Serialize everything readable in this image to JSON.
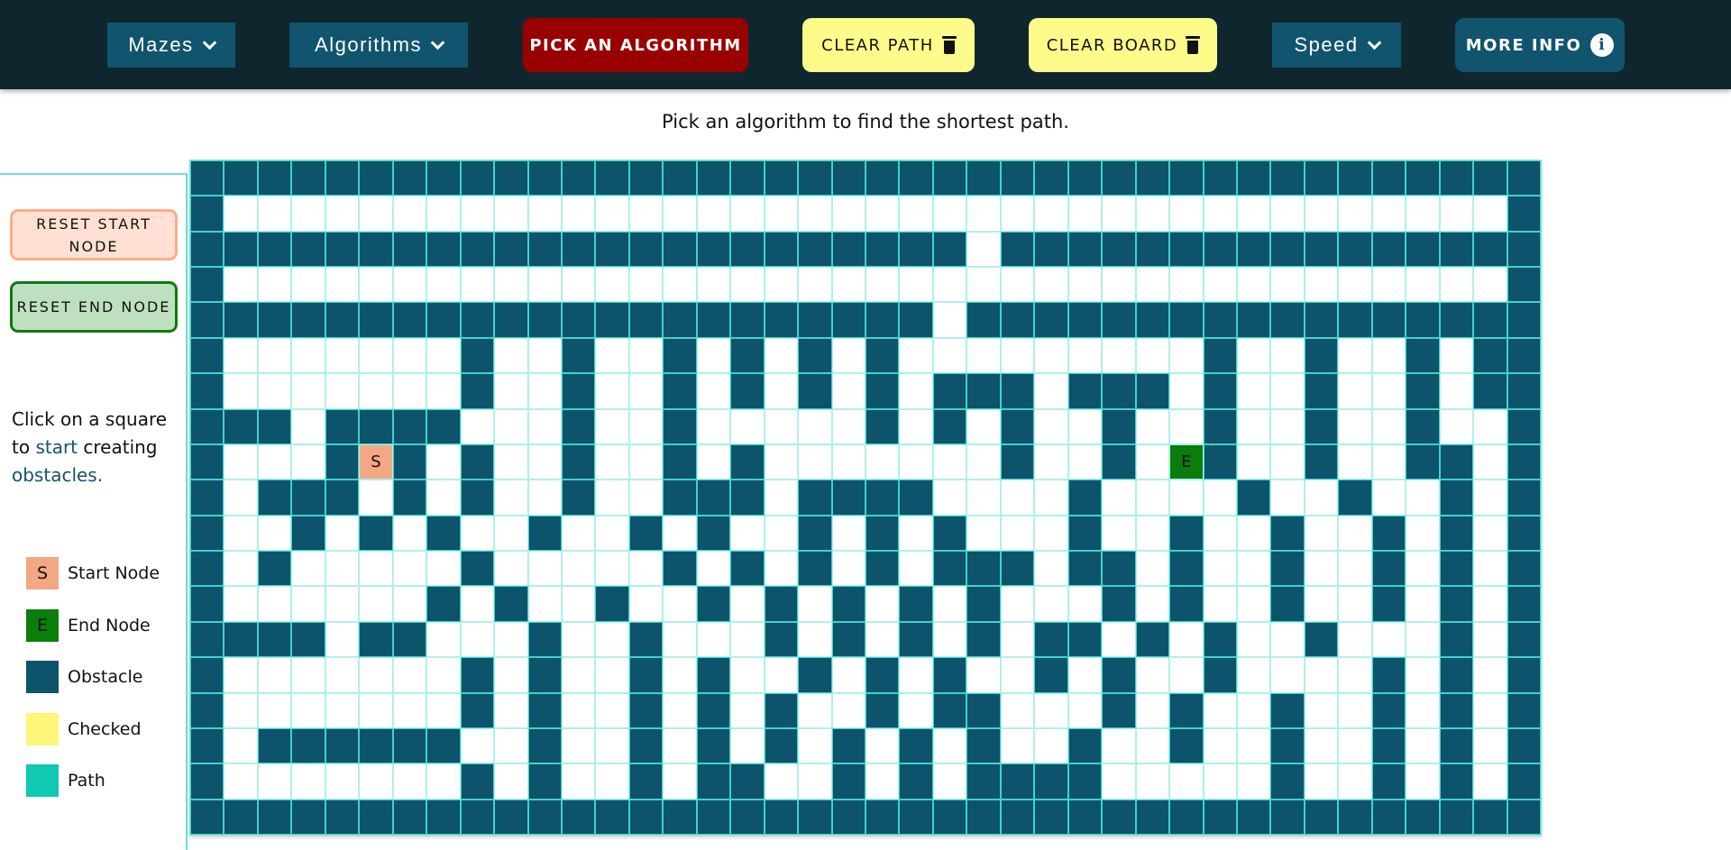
{
  "nav": {
    "mazes_label": "Mazes",
    "algorithms_label": "Algorithms",
    "pick_label": "PICK AN ALGORITHM",
    "clear_path_label": "CLEAR PATH",
    "clear_board_label": "CLEAR BOARD",
    "speed_label": "Speed",
    "more_info_label": "MORE INFO"
  },
  "subtitle": "Pick an algorithm to find the shortest path.",
  "sidebar": {
    "reset_start_label": "RESET START NODE",
    "reset_end_label": "RESET END NODE",
    "help_pre": "Click on a square to ",
    "help_start": "start",
    "help_mid": " creating ",
    "help_obstacles": "obstacles."
  },
  "legend": [
    {
      "label": "Start Node",
      "symbol": "S",
      "color": "#f4a785"
    },
    {
      "label": "End Node",
      "symbol": "E",
      "color": "#0b7d0b"
    },
    {
      "label": "Obstacle",
      "symbol": "",
      "color": "#0c536b"
    },
    {
      "label": "Checked",
      "symbol": "",
      "color": "#fdf67a"
    },
    {
      "label": "Path",
      "symbol": "",
      "color": "#0fc9b3"
    }
  ],
  "colors": {
    "topbar": "#10262f",
    "nav_button": "#11546d",
    "pick_button": "#990000",
    "clear_button": "#fdfc8b",
    "wall": "#0c536b",
    "grid_line": "#aef0ec",
    "start": "#f4a785",
    "end": "#0b7d0b"
  },
  "grid": {
    "rows": 19,
    "cols": 40,
    "start_symbol": "S",
    "end_symbol": "E",
    "cells": [
      "########################################",
      "#......................................#",
      "#######################.################",
      "#......................................#",
      "######################.#################",
      "#.......#..#..#.#.#.#.........#..#..#.##",
      "#.......#..#..#.#.#.#.###.###.#..#..#.##",
      "###.####...#..#.....#.#.#..#..#..#..#..#",
      "#...#S#.#..#..#.#.......#..#.E#..#..##.#",
      "#.###.#.#..#..###.####....#....#..#..#.#",
      "#..#.#.#..#..#.#..#.#.#...#..#..#..#.#.#",
      "#.#.....#.....#.#.#.#.###.##.#..#..#.#.#",
      "#......#.#..#..#.#.#.#.#...#.#..#..#.#.#",
      "####.##...#..#...#.#.#.#.##.#.#..#...#.#",
      "#.......#.#..#.#..#.#.#..#.#..#....#.#.#",
      "#.......#.#..#.#.#..#.##...#.#..#..#.#.#",
      "#.######..#..#.#.#.#.#.#..#..#..#..#.#.#",
      "#.......#.#..#.##..#.#.####.....#..#.#.#",
      "########################################"
    ]
  }
}
